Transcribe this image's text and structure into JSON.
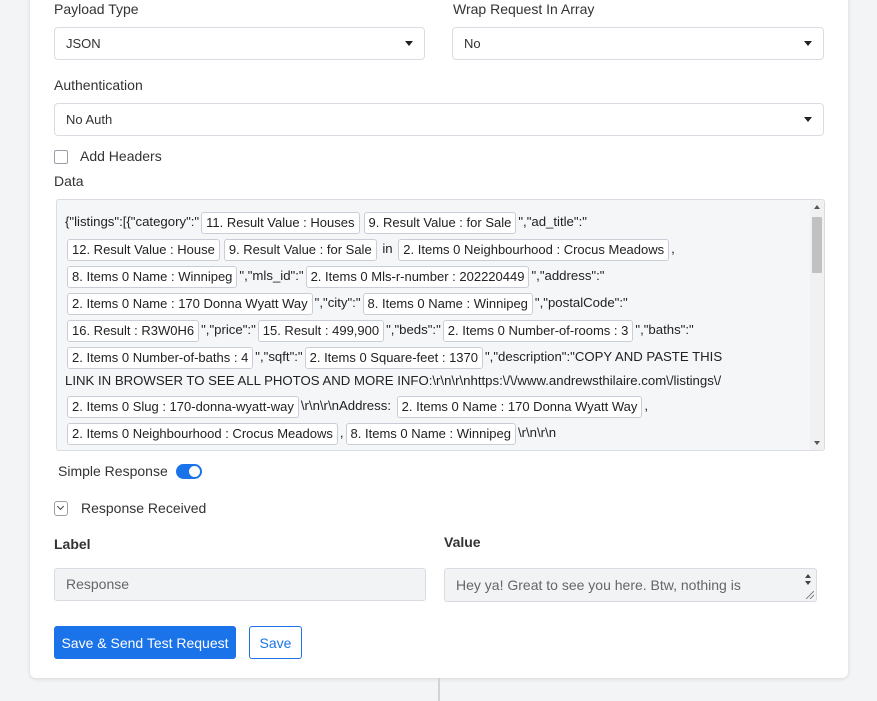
{
  "payload_type": {
    "label": "Payload Type",
    "value": "JSON"
  },
  "wrap_request": {
    "label": "Wrap Request In Array",
    "value": "No"
  },
  "authentication": {
    "label": "Authentication",
    "value": "No Auth"
  },
  "add_headers": {
    "label": "Add Headers",
    "checked": false
  },
  "data_section": {
    "label": "Data",
    "lines": [
      [
        {
          "t": "text",
          "v": "{\"listings\":[{\"category\":\""
        },
        {
          "t": "chip",
          "v": "11. Result Value : Houses"
        },
        {
          "t": "chip",
          "v": "9. Result Value : for Sale"
        },
        {
          "t": "text",
          "v": "\",\"ad_title\":\""
        }
      ],
      [
        {
          "t": "chip",
          "v": "12. Result Value : House"
        },
        {
          "t": "chip",
          "v": "9. Result Value : for Sale"
        },
        {
          "t": "text",
          "v": " in "
        },
        {
          "t": "chip",
          "v": "2. Items 0 Neighbourhood : Crocus Meadows"
        },
        {
          "t": "text",
          "v": ","
        }
      ],
      [
        {
          "t": "chip",
          "v": "8. Items 0 Name : Winnipeg"
        },
        {
          "t": "text",
          "v": "\",\"mls_id\":\""
        },
        {
          "t": "chip",
          "v": "2. Items 0 Mls-r-number : 202220449"
        },
        {
          "t": "text",
          "v": "\",\"address\":\""
        }
      ],
      [
        {
          "t": "chip",
          "v": "2. Items 0 Name : 170 Donna Wyatt Way"
        },
        {
          "t": "text",
          "v": "\",\"city\":\""
        },
        {
          "t": "chip",
          "v": "8. Items 0 Name : Winnipeg"
        },
        {
          "t": "text",
          "v": "\",\"postalCode\":\""
        }
      ],
      [
        {
          "t": "chip",
          "v": "16. Result : R3W0H6"
        },
        {
          "t": "text",
          "v": "\",\"price\":\""
        },
        {
          "t": "chip",
          "v": "15. Result : 499,900"
        },
        {
          "t": "text",
          "v": "\",\"beds\":\""
        },
        {
          "t": "chip",
          "v": "2. Items 0 Number-of-rooms : 3"
        },
        {
          "t": "text",
          "v": "\",\"baths\":\""
        }
      ],
      [
        {
          "t": "chip",
          "v": "2. Items 0 Number-of-baths : 4"
        },
        {
          "t": "text",
          "v": "\",\"sqft\":\""
        },
        {
          "t": "chip",
          "v": "2. Items 0 Square-feet : 1370"
        },
        {
          "t": "text",
          "v": "\",\"description\":\"COPY AND PASTE THIS"
        }
      ],
      [
        {
          "t": "text",
          "v": "LINK IN BROWSER TO SEE ALL PHOTOS AND MORE INFO:\\r\\n\\r\\nhttps:\\/\\/www.andrewsthilaire.com\\/listings\\/"
        }
      ],
      [
        {
          "t": "chip",
          "v": "2. Items 0 Slug : 170-donna-wyatt-way"
        },
        {
          "t": "text",
          "v": "\\r\\n\\r\\nAddress: "
        },
        {
          "t": "chip",
          "v": "2. Items 0 Name : 170 Donna Wyatt Way"
        },
        {
          "t": "text",
          "v": ","
        }
      ],
      [
        {
          "t": "chip",
          "v": "2. Items 0 Neighbourhood : Crocus Meadows"
        },
        {
          "t": "text",
          "v": ","
        },
        {
          "t": "chip",
          "v": "8. Items 0 Name : Winnipeg"
        },
        {
          "t": "text",
          "v": "\\r\\n\\r\\n"
        }
      ]
    ]
  },
  "simple_response": {
    "label": "Simple Response",
    "enabled": true
  },
  "response_received": {
    "label": "Response Received"
  },
  "table": {
    "label_header": "Label",
    "value_header": "Value",
    "label_value": "Response",
    "value_text": "Hey ya! Great to see you here. Btw, nothing is configured for this request path. Create a rule and start building a mock API."
  },
  "buttons": {
    "save_send": "Save & Send Test Request",
    "save": "Save"
  },
  "colors": {
    "accent": "#1a73e8",
    "field_bg": "#f1f3f5",
    "data_bg": "#f5f6f8"
  }
}
